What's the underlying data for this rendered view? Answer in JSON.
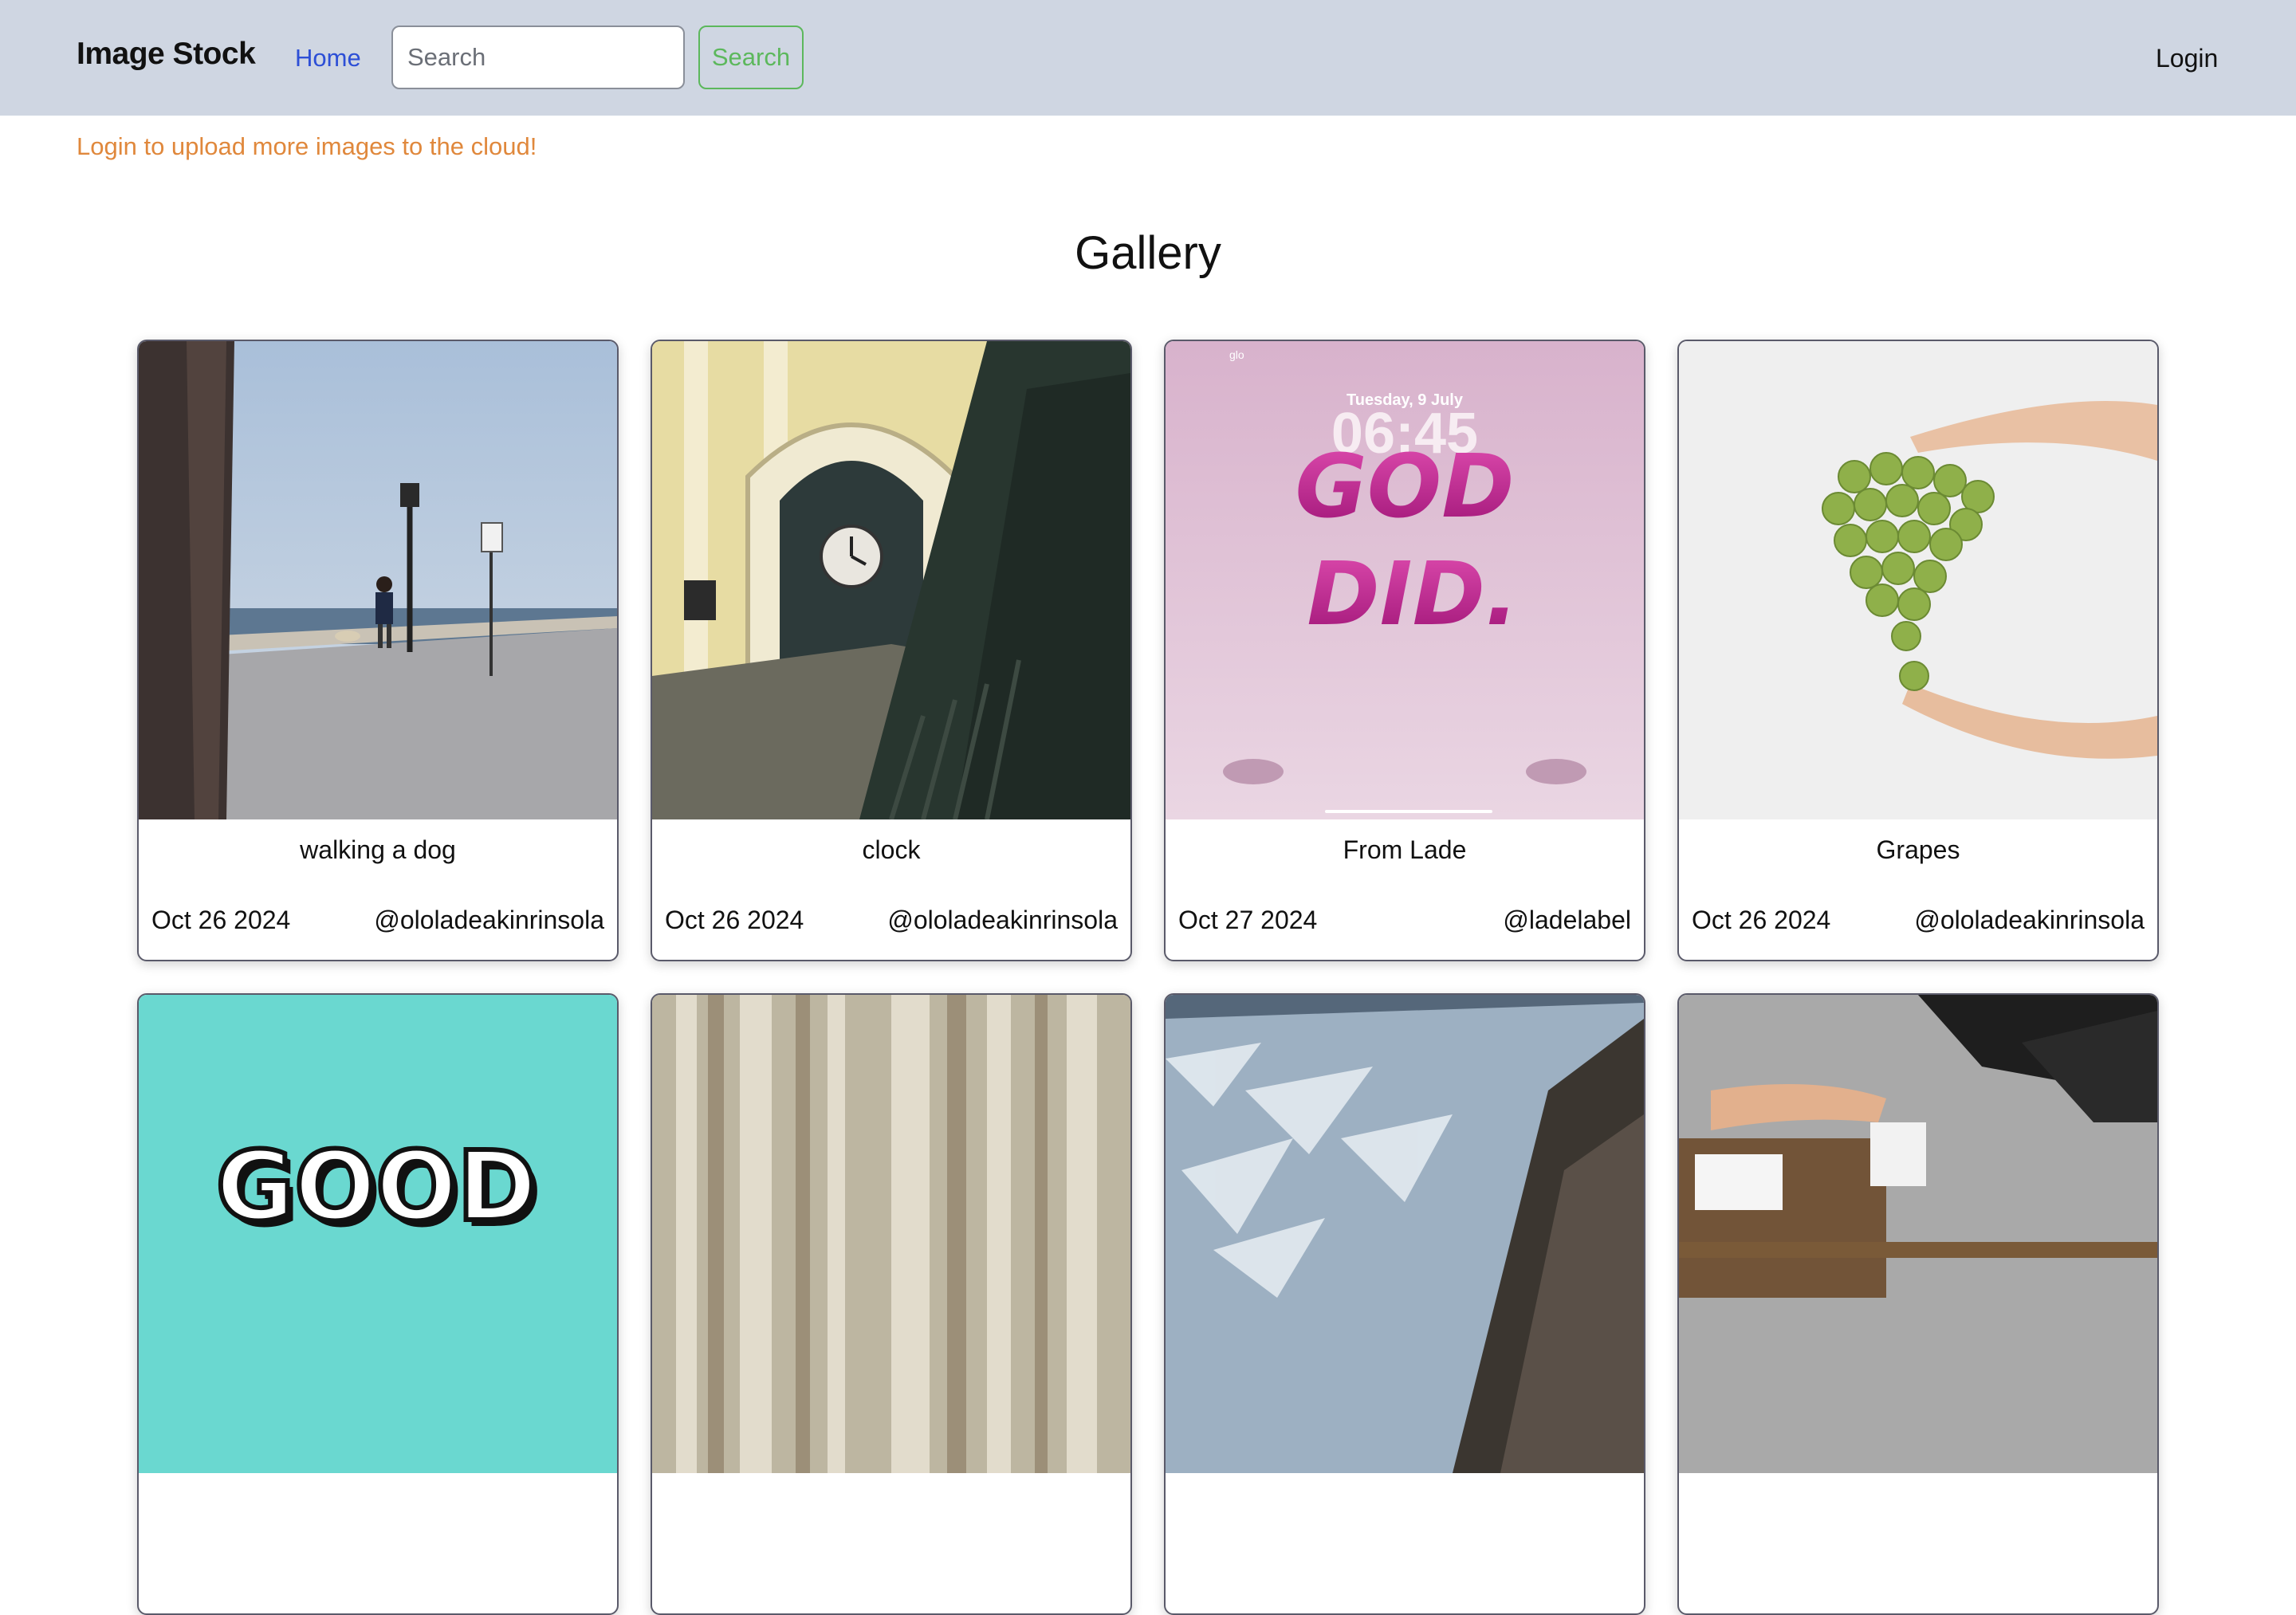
{
  "navbar": {
    "brand": "Image Stock",
    "home_label": "Home",
    "search_placeholder": "Search",
    "search_button": "Search",
    "login_label": "Login"
  },
  "notice": "Login to upload more images to the cloud!",
  "gallery": {
    "title": "Gallery",
    "cards": [
      {
        "caption": "walking a dog",
        "date": "Oct 26 2024",
        "author": "@ololadeakinrinsola"
      },
      {
        "caption": "clock",
        "date": "Oct 26 2024",
        "author": "@ololadeakinrinsola"
      },
      {
        "caption": "From Lade",
        "date": "Oct 27 2024",
        "author": "@ladelabel"
      },
      {
        "caption": "Grapes",
        "date": "Oct 26 2024",
        "author": "@ololadeakinrinsola"
      }
    ],
    "image3_text": {
      "status": "glo",
      "date": "Tuesday, 9 July",
      "time": "06:45",
      "line1": "GOD",
      "line2": "DID."
    },
    "image5_text": "GOOD"
  },
  "colors": {
    "navbar_bg": "#cfd6e2",
    "home_link": "#2d4fd6",
    "search_button": "#5cb85c",
    "notice": "#e0883c"
  }
}
